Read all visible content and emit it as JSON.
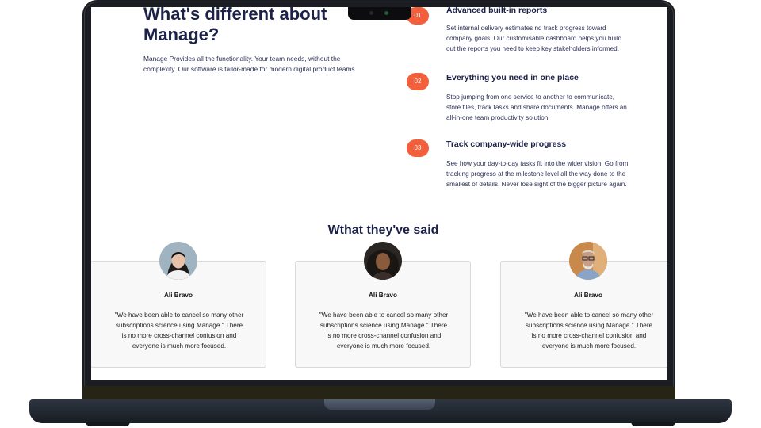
{
  "hero": {
    "heading": "What's different about Manage?",
    "description": "Manage Provides all the functionality. Your team needs, without the complexity. Our software is tailor-made for modern digital product teams"
  },
  "features": [
    {
      "number": "01",
      "title": "Advanced built-in reports",
      "description": "Set internal delivery estimates nd track progress toward company goals. Our customisable dashboard helps you build out the reports you need to keep key stakeholders informed."
    },
    {
      "number": "02",
      "title": "Everything you need in one place",
      "description": "Stop jumping from one service to another to communicate, store files, track tasks and share documents. Manage offers an all-in-one team productivity solution."
    },
    {
      "number": "03",
      "title": "Track company-wide progress",
      "description": "See how your day-to-day tasks fit into the wider vision. Go from tracking progress at the milestone level all the way done to the smallest of details. Never lose sight of the bigger picture again."
    }
  ],
  "testimonials": {
    "title": "Wthat they've said",
    "items": [
      {
        "name": "Ali Bravo",
        "quote": "\"We have been able to cancel so many other subscriptions science using Manage.\" There is no more cross-channel confusion and everyone is much more focused."
      },
      {
        "name": "Ali Bravo",
        "quote": "\"We have been able to cancel so many other subscriptions science using Manage.\" There is no more cross-channel confusion and everyone is much more focused."
      },
      {
        "name": "Ali Bravo",
        "quote": "\"We have been able to cancel so many other subscriptions science using Manage.\" There is no more cross-channel confusion and everyone is much more focused."
      }
    ]
  },
  "colors": {
    "accent": "#f25f3a",
    "heading": "#1c2148",
    "card_background": "#f8f8f8"
  }
}
